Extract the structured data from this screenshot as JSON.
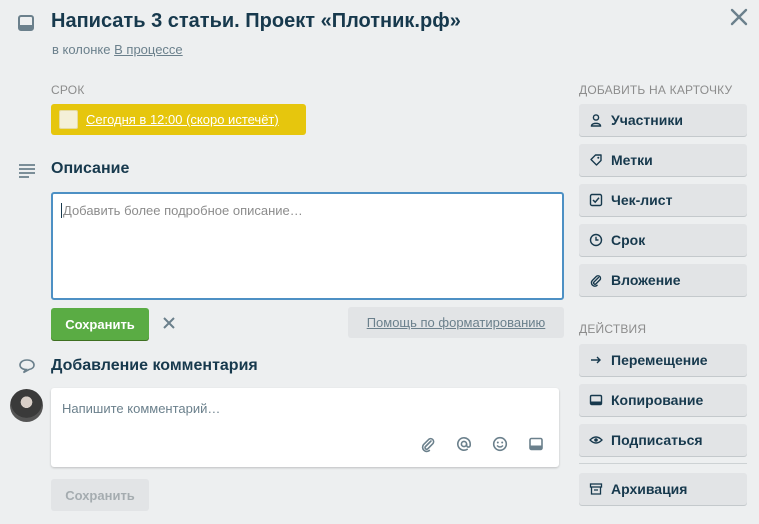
{
  "card": {
    "title": "Написать 3 статьи. Проект «Плотник.рф»",
    "list_prefix": "в колонке",
    "list_name": "В процессе"
  },
  "due": {
    "section_label": "СРОК",
    "value": "Сегодня в 12:00 (скоро истечёт)",
    "color": "#e6c60d"
  },
  "description": {
    "heading": "Описание",
    "placeholder": "Добавить более подробное описание…",
    "save_label": "Сохранить",
    "format_help_label": "Помощь по форматированию"
  },
  "comment": {
    "heading": "Добавление комментария",
    "placeholder": "Напишите комментарий…",
    "icons": [
      "attachment-icon",
      "mention-icon",
      "emoji-icon",
      "card-icon"
    ],
    "save_label": "Сохранить"
  },
  "sidebar": {
    "add_heading": "ДОБАВИТЬ НА КАРТОЧКУ",
    "add_items": [
      {
        "label": "Участники",
        "icon": "person-icon"
      },
      {
        "label": "Метки",
        "icon": "label-icon"
      },
      {
        "label": "Чек-лист",
        "icon": "checklist-icon"
      },
      {
        "label": "Срок",
        "icon": "clock-icon"
      },
      {
        "label": "Вложение",
        "icon": "paperclip-icon"
      }
    ],
    "actions_heading": "ДЕЙСТВИЯ",
    "action_items": [
      {
        "label": "Перемещение",
        "icon": "arrow-right-icon"
      },
      {
        "label": "Копирование",
        "icon": "card-icon"
      },
      {
        "label": "Подписаться",
        "icon": "eye-icon"
      },
      {
        "label": "Архивация",
        "icon": "archive-icon"
      }
    ]
  },
  "colors": {
    "save_button": "#5aac44",
    "focus_border": "#4d90c4",
    "background": "#edeff0"
  }
}
